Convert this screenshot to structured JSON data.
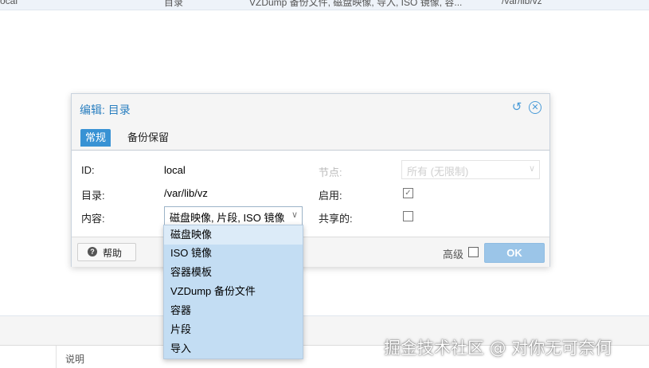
{
  "background": {
    "row": {
      "name": "ocal",
      "type": "目录",
      "content": "VZDump 备份文件, 磁盘映像, 导入, ISO 镜像, 容...",
      "path": "/var/lib/vz"
    },
    "desc_header": "说明",
    "watermark": "掘金技术社区 @ 对你无可奈何"
  },
  "dialog": {
    "title": "编辑: 目录",
    "tabs": [
      {
        "label": "常规",
        "active": true
      },
      {
        "label": "备份保留",
        "active": false
      }
    ],
    "fields": {
      "id_label": "ID:",
      "id_value": "local",
      "dir_label": "目录:",
      "dir_value": "/var/lib/vz",
      "content_label": "内容:",
      "content_value": "磁盘映像, 片段, ISO 镜像",
      "node_label": "节点:",
      "node_value": "所有 (无限制)",
      "enable_label": "启用:",
      "enable_checked": true,
      "shared_label": "共享的:",
      "shared_checked": false
    },
    "footer": {
      "help_label": "帮助",
      "advanced_label": "高级",
      "advanced_checked": false,
      "ok_label": "OK"
    }
  },
  "dropdown": {
    "items": [
      "磁盘映像",
      "ISO 镜像",
      "容器模板",
      "VZDump 备份文件",
      "容器",
      "片段",
      "导入"
    ]
  },
  "colors": {
    "accent": "#3892d4",
    "title": "#2a7fc0",
    "dropdown_bg": "#c3ddf3",
    "ok_disabled": "#9bc5e8"
  }
}
